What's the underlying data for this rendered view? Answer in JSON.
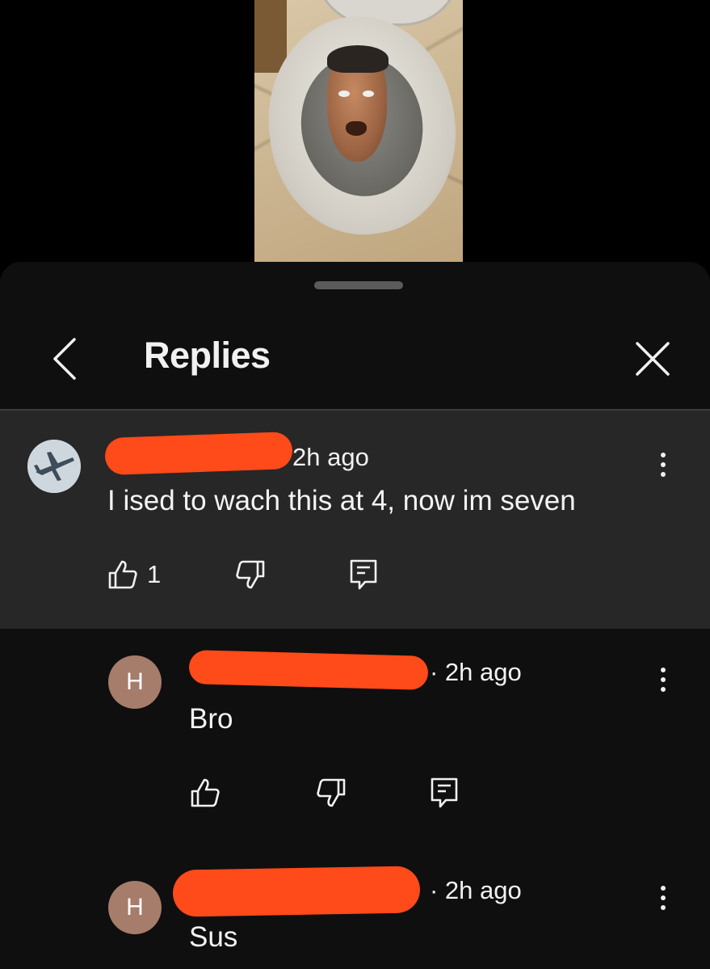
{
  "video": {
    "thumbnail_icon": "toilet-head-video-frame"
  },
  "sheet": {
    "title": "Replies",
    "back_icon": "chevron-left-icon",
    "close_icon": "close-icon"
  },
  "comments": [
    {
      "avatar_icon": "airplane-avatar",
      "author_redacted": true,
      "time": "2h ago",
      "text": "I ised to wach this at 4, now im seven",
      "likes": "1"
    },
    {
      "avatar_letter": "H",
      "author_redacted": true,
      "time": "· 2h ago",
      "text": "Bro",
      "likes": ""
    },
    {
      "avatar_letter": "H",
      "author_redacted": true,
      "time": "· 2h ago",
      "text": "Sus"
    }
  ],
  "colors": {
    "background": "#0f0f0f",
    "highlight_comment": "#272727",
    "redaction": "#ff4a1a",
    "avatar_h": "#a67c6a"
  }
}
